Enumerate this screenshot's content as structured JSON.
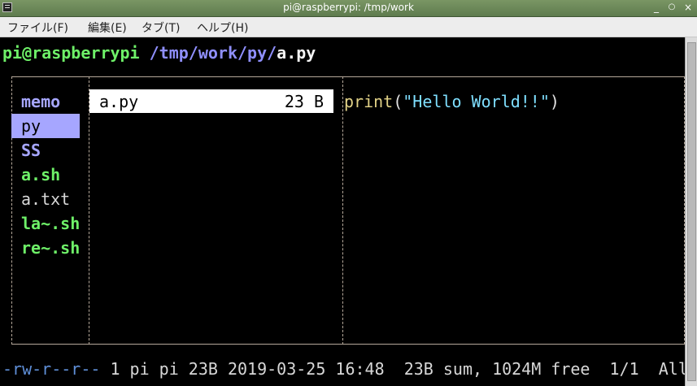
{
  "window": {
    "title": "pi@raspberrypi: /tmp/work",
    "controls": {
      "minimize": "_",
      "maximize": "○",
      "close": "×"
    }
  },
  "menu": [
    "ファイル(F)",
    "編集(E)",
    "タブ(T)",
    "ヘルプ(H)"
  ],
  "prompt": {
    "user_host": "pi@raspberrypi",
    "path": " /tmp/work/py/",
    "file": "a.py"
  },
  "panes": {
    "parent_items": [
      {
        "name": "memo",
        "type": "dir"
      },
      {
        "name": "py",
        "type": "dir",
        "selected": true
      },
      {
        "name": "SS",
        "type": "dir"
      },
      {
        "name": "a.sh",
        "type": "exe"
      },
      {
        "name": "a.txt",
        "type": "plain"
      },
      {
        "name": "la~.sh",
        "type": "exe"
      },
      {
        "name": "re~.sh",
        "type": "exe"
      }
    ],
    "current_file": {
      "name": "a.py",
      "size": "23 B"
    },
    "preview": {
      "func": "print",
      "open": "(",
      "string": "\"Hello World!!\"",
      "close": ")"
    }
  },
  "status": {
    "perms": "-rw-r--r--",
    "info": " 1 pi pi 23B 2019-03-25 16:48  23B sum, 1024M free  1/1  All"
  },
  "colors": {
    "dir": "#a6a6ff",
    "exe": "#6ef068",
    "plain": "#d7d7d7",
    "titlebar": "#6a8758"
  }
}
